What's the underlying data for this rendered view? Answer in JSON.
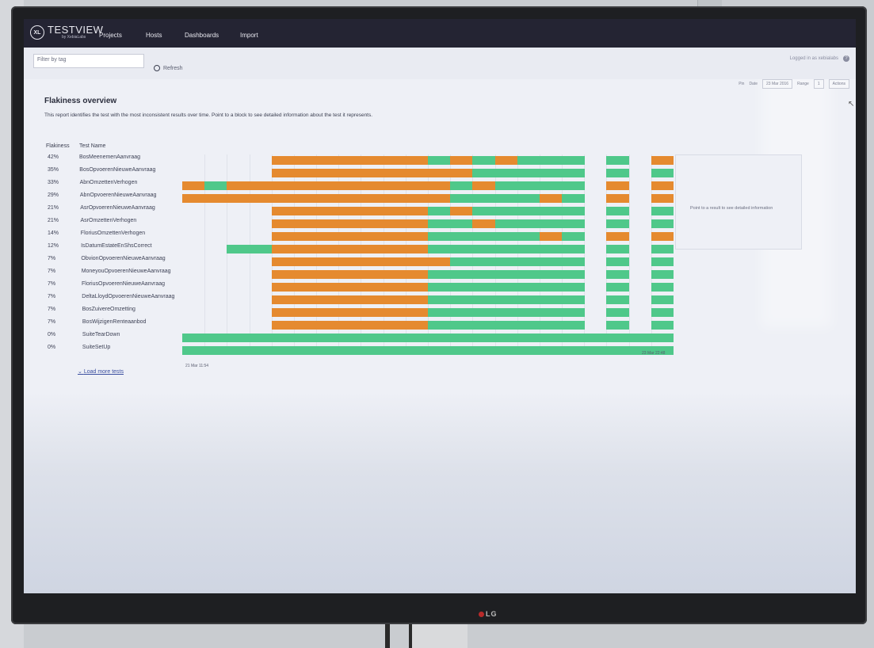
{
  "app": {
    "brand": "TESTVIEW",
    "brand_sub": "by XebiaLabs",
    "brand_badge": "XL"
  },
  "nav": {
    "items": [
      "Projects",
      "Hosts",
      "Dashboards",
      "Import"
    ]
  },
  "user": {
    "logged_in_label": "Logged in as xebialabs",
    "help_icon": "?"
  },
  "filter": {
    "placeholder": "Filter by tag",
    "refresh_label": "Refresh"
  },
  "toolbar": {
    "pin_label": "Pin",
    "date_label": "Date",
    "date_value": "23 Mar 2016",
    "range_label": "Range",
    "range_value": "1",
    "more_label": "Actions"
  },
  "report": {
    "title": "Flakiness overview",
    "description": "This report identifies the test with the most inconsistent results over time. Point to a block to see detailed information about the test it represents.",
    "col_flakiness": "Flakiness",
    "col_test_name": "Test Name",
    "info_hint": "Point to a result to see detailed information",
    "load_more": "Load more tests",
    "axis_start": "21 Mar 11:54",
    "axis_end": "23 Mar 22:48"
  },
  "tests": [
    {
      "flakiness": "42%",
      "name": "BosMeenemenAanvraag"
    },
    {
      "flakiness": "35%",
      "name": "BosOpvoerenNieuweAanvraag"
    },
    {
      "flakiness": "33%",
      "name": "AbnOmzettenVerhogen"
    },
    {
      "flakiness": "29%",
      "name": "AbnOpvoerenNieuweAanvraag"
    },
    {
      "flakiness": "21%",
      "name": "AsrOpvoerenNieuweAanvraag"
    },
    {
      "flakiness": "21%",
      "name": "AsrOmzettenVerhogen"
    },
    {
      "flakiness": "14%",
      "name": "FloriusOmzettenVerhogen"
    },
    {
      "flakiness": "12%",
      "name": "IsDatumEstateEnShsCorrect"
    },
    {
      "flakiness": "7%",
      "name": "ObvionOpvoerenNieuweAanvraag"
    },
    {
      "flakiness": "7%",
      "name": "MoneyouOpvoerenNieuweAanvraag"
    },
    {
      "flakiness": "7%",
      "name": "FloriusOpvoerenNieuweAanvraag"
    },
    {
      "flakiness": "7%",
      "name": "DeltaLloydOpvoerenNieuweAanvraag"
    },
    {
      "flakiness": "7%",
      "name": "BosZuivereOmzetting"
    },
    {
      "flakiness": "7%",
      "name": "BosWijzigenRenteaanbod"
    },
    {
      "flakiness": "0%",
      "name": "SuiteTearDown"
    },
    {
      "flakiness": "0%",
      "name": "SuiteSetUp"
    }
  ],
  "colors": {
    "pass": "#4fc88a",
    "fail": "#e58a2f",
    "nav_bg": "#242433"
  },
  "runs": {
    "columns": 20,
    "results": [
      "....FFFFFFFPFPFPPP.P.F",
      "....FFFFFFFFFPPPPP.P.P",
      "FPFFFFFFFFFFPFPPPP.F.F",
      "FFFFFFFFFFFFPPPPFP.F.F",
      "....FFFFFFFPFPPPPP.P.P",
      "....FFFFFFFPPFPPPP.P.P",
      "....FFFFFFFPPPPPFP.F.F",
      "..PPFFFFFFFPPPPPPP.P.P",
      "....FFFFFFFFPPPPPP.P.P",
      "....FFFFFFFPPPPPPP.P.P",
      "....FFFFFFFPPPPPPP.P.P",
      "....FFFFFFFPPPPPPP.P.P",
      "....FFFFFFFPPPPPPP.P.P",
      "....FFFFFFFPPPPPPP.P.P",
      "PPPPPPPPPPPPPPPPPPPPPP",
      "PPPPPPPPPPPPPPPPPPPPPP"
    ]
  }
}
